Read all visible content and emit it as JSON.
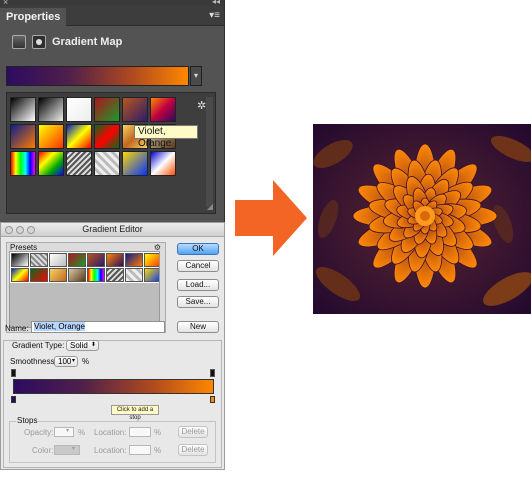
{
  "properties_panel": {
    "tab_label": "Properties",
    "adjustment_title": "Gradient Map",
    "gradient_stops_colors": [
      "#2c0b61",
      "#ff8700"
    ],
    "tooltip": "Violet, Orange",
    "swatch_gradients": [
      "linear-gradient(135deg,#000,#fff)",
      "linear-gradient(135deg,#000,rgba(0,0,0,0))",
      "linear-gradient(135deg,#fff,rgba(255,255,255,0))",
      "linear-gradient(135deg,#b0141b,#1a9a2a)",
      "linear-gradient(135deg,#b7571a,#2e1a6e)",
      "linear-gradient(135deg,#ff8700,#c00040,#2c0b61)",
      "linear-gradient(135deg,#0b1e8a,#ff7a00)",
      "linear-gradient(135deg,#ff0,#f30)",
      "linear-gradient(135deg,#0020c0,#ff0,#f00)",
      "linear-gradient(135deg,#0a6a1d,#f00,#0a6a1d)",
      "linear-gradient(135deg,#f6d365,#c2671f,#f6d365)",
      "linear-gradient(135deg,#d7c7a6,#5b3a1a)",
      "linear-gradient(90deg,#f00,#ff0,#0f0,#0ff,#00f,#f0f)",
      "linear-gradient(135deg,#f00,#ff0,#0a0,#00f)",
      "repeating-linear-gradient(135deg,#555 0 2px,#ddd 2px 4px)",
      "repeating-linear-gradient(45deg,#eee 0 3px,#bbb 3px 6px)",
      "linear-gradient(135deg,#ffd800,#0033ff)",
      "linear-gradient(135deg,#0000d0,#ffffff,#ff4e00)"
    ]
  },
  "gradient_editor": {
    "window_title": "Gradient Editor",
    "presets_label": "Presets",
    "buttons": {
      "ok": "OK",
      "cancel": "Cancel",
      "load": "Load...",
      "save": "Save...",
      "new": "New"
    },
    "name_label": "Name:",
    "name_value": "Violet, Orange",
    "gradient_type_label": "Gradient Type:",
    "gradient_type_value": "Solid",
    "smoothness_label": "Smoothness:",
    "smoothness_value": "100",
    "percent": "%",
    "hint": "Click to add a stop",
    "stops": {
      "section_label": "Stops",
      "opacity_label": "Opacity:",
      "color_label": "Color:",
      "location_label": "Location:",
      "delete_label": "Delete"
    },
    "preset_gradients": [
      "linear-gradient(135deg,#000,#fff)",
      "repeating-linear-gradient(45deg,#ddd 0 2px,#888 2px 4px)",
      "linear-gradient(135deg,#fff,#bbb)",
      "linear-gradient(135deg,#b0141b,#1a9a2a)",
      "linear-gradient(135deg,#b7571a,#2e1a6e)",
      "linear-gradient(135deg,#ff8700,#2c0b61)",
      "linear-gradient(135deg,#0b1e8a,#ff7a00)",
      "linear-gradient(135deg,#ff0,#f30)",
      "linear-gradient(135deg,#0020c0,#ff0,#f00)",
      "linear-gradient(135deg,#0a6a1d,#f00)",
      "linear-gradient(135deg,#f6d365,#c2671f)",
      "linear-gradient(135deg,#d7c7a6,#5b3a1a)",
      "linear-gradient(90deg,#f00,#ff0,#0f0,#0ff,#00f,#f0f)",
      "repeating-linear-gradient(135deg,#555 0 2px,#ddd 2px 4px)",
      "repeating-linear-gradient(45deg,#eee 0 3px,#bbb 3px 6px)",
      "linear-gradient(135deg,#ffd800,#0033ff)"
    ]
  },
  "colors": {
    "accent_arrow": "#f26524",
    "photo_dark": "#2a0d3a",
    "photo_light": "#ff7d00"
  }
}
